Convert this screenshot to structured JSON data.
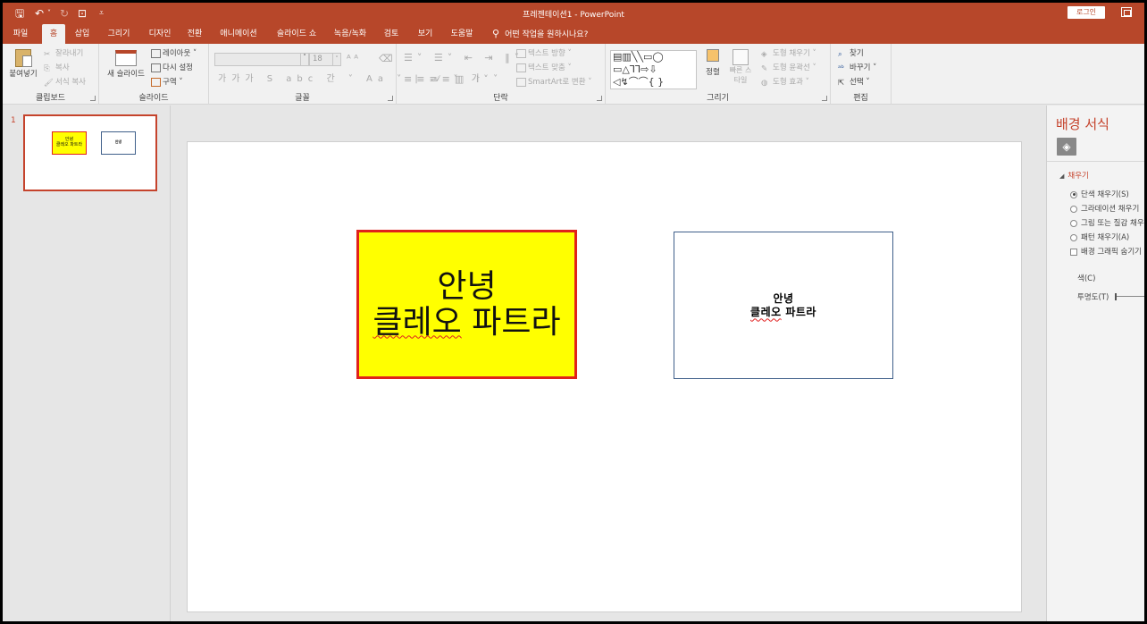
{
  "app": {
    "title": "프레젠테이션1 - PowerPoint",
    "login_label": "로그인"
  },
  "tabs": [
    "파일",
    "홈",
    "삽입",
    "그리기",
    "디자인",
    "전환",
    "애니메이션",
    "슬라이드 쇼",
    "녹음/녹화",
    "검토",
    "보기",
    "도움말"
  ],
  "active_tab": "홈",
  "tellme": "어떤 작업을 원하시나요?",
  "ribbon": {
    "clipboard": {
      "paste": "붙여넣기",
      "cut": "잘라내기",
      "copy": "복사",
      "format_painter": "서식 복사",
      "label": "클립보드"
    },
    "slides": {
      "new_slide": "새 슬라이드",
      "layout": "레이아웃",
      "reset": "다시 설정",
      "section": "구역",
      "label": "슬라이드"
    },
    "font": {
      "font_name": "",
      "font_size": "18",
      "label": "글꼴"
    },
    "paragraph": {
      "text_direction": "텍스트 방향",
      "align_text": "텍스트 맞춤",
      "smartart": "SmartArt로 변환",
      "label": "단락"
    },
    "drawing": {
      "arrange": "정렬",
      "quick_styles": "빠른 스타일",
      "shape_fill": "도형 채우기",
      "shape_outline": "도형 윤곽선",
      "shape_effects": "도형 효과",
      "label": "그리기"
    },
    "editing": {
      "find": "찾기",
      "replace": "바꾸기",
      "select": "선택",
      "label": "편집"
    }
  },
  "thumbs": {
    "number": "1"
  },
  "slide": {
    "box1_line1": "안녕",
    "box1_line2a": "클레오",
    "box1_line2b": "파트라",
    "box2_line1": "안녕",
    "box2_line2a": "클레오",
    "box2_line2b": "파트라"
  },
  "format_pane": {
    "title": "배경 서식",
    "section": "채우기",
    "options": [
      "단색 채우기(S)",
      "그라데이션 채우기",
      "그림 또는 질감 채우",
      "패턴 채우기(A)"
    ],
    "hide_graphics": "배경 그래픽 숨기기",
    "color_label": "색(C)",
    "transparency_label": "투명도(T)"
  }
}
